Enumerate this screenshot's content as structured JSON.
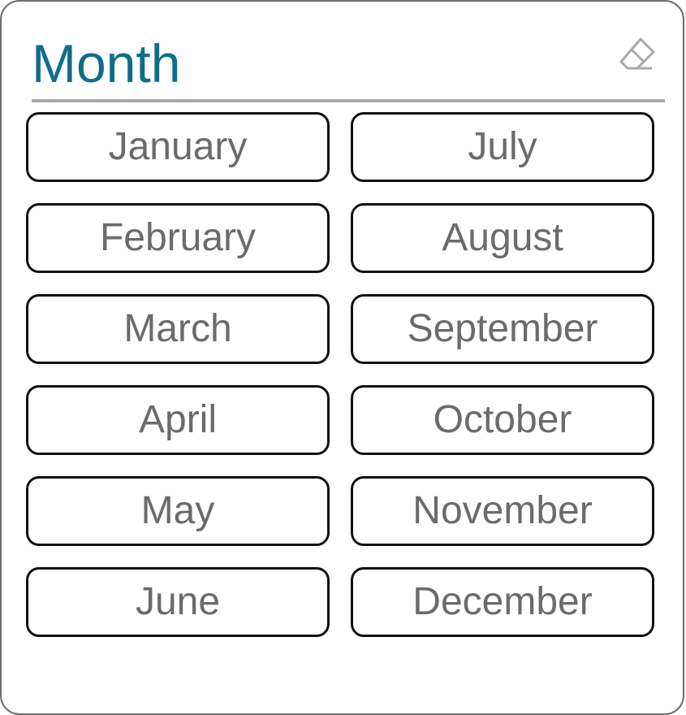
{
  "panel": {
    "title": "Month",
    "clear_icon": "eraser-icon"
  },
  "months": [
    "January",
    "February",
    "March",
    "April",
    "May",
    "June",
    "July",
    "August",
    "September",
    "October",
    "November",
    "December"
  ],
  "colors": {
    "title": "#0f6e8a",
    "button_text": "#6b6b6b",
    "button_border": "#111111",
    "divider": "#a8a8a8"
  }
}
